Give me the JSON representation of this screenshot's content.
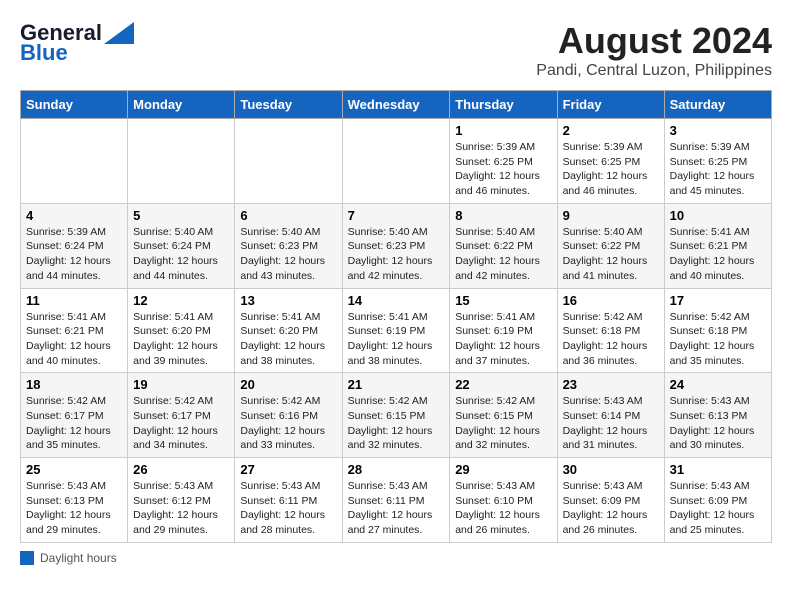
{
  "header": {
    "logo_general": "General",
    "logo_blue": "Blue",
    "month_year": "August 2024",
    "location": "Pandi, Central Luzon, Philippines"
  },
  "days_of_week": [
    "Sunday",
    "Monday",
    "Tuesday",
    "Wednesday",
    "Thursday",
    "Friday",
    "Saturday"
  ],
  "weeks": [
    [
      {
        "day": "",
        "info": ""
      },
      {
        "day": "",
        "info": ""
      },
      {
        "day": "",
        "info": ""
      },
      {
        "day": "",
        "info": ""
      },
      {
        "day": "1",
        "info": "Sunrise: 5:39 AM\nSunset: 6:25 PM\nDaylight: 12 hours\nand 46 minutes."
      },
      {
        "day": "2",
        "info": "Sunrise: 5:39 AM\nSunset: 6:25 PM\nDaylight: 12 hours\nand 46 minutes."
      },
      {
        "day": "3",
        "info": "Sunrise: 5:39 AM\nSunset: 6:25 PM\nDaylight: 12 hours\nand 45 minutes."
      }
    ],
    [
      {
        "day": "4",
        "info": "Sunrise: 5:39 AM\nSunset: 6:24 PM\nDaylight: 12 hours\nand 44 minutes."
      },
      {
        "day": "5",
        "info": "Sunrise: 5:40 AM\nSunset: 6:24 PM\nDaylight: 12 hours\nand 44 minutes."
      },
      {
        "day": "6",
        "info": "Sunrise: 5:40 AM\nSunset: 6:23 PM\nDaylight: 12 hours\nand 43 minutes."
      },
      {
        "day": "7",
        "info": "Sunrise: 5:40 AM\nSunset: 6:23 PM\nDaylight: 12 hours\nand 42 minutes."
      },
      {
        "day": "8",
        "info": "Sunrise: 5:40 AM\nSunset: 6:22 PM\nDaylight: 12 hours\nand 42 minutes."
      },
      {
        "day": "9",
        "info": "Sunrise: 5:40 AM\nSunset: 6:22 PM\nDaylight: 12 hours\nand 41 minutes."
      },
      {
        "day": "10",
        "info": "Sunrise: 5:41 AM\nSunset: 6:21 PM\nDaylight: 12 hours\nand 40 minutes."
      }
    ],
    [
      {
        "day": "11",
        "info": "Sunrise: 5:41 AM\nSunset: 6:21 PM\nDaylight: 12 hours\nand 40 minutes."
      },
      {
        "day": "12",
        "info": "Sunrise: 5:41 AM\nSunset: 6:20 PM\nDaylight: 12 hours\nand 39 minutes."
      },
      {
        "day": "13",
        "info": "Sunrise: 5:41 AM\nSunset: 6:20 PM\nDaylight: 12 hours\nand 38 minutes."
      },
      {
        "day": "14",
        "info": "Sunrise: 5:41 AM\nSunset: 6:19 PM\nDaylight: 12 hours\nand 38 minutes."
      },
      {
        "day": "15",
        "info": "Sunrise: 5:41 AM\nSunset: 6:19 PM\nDaylight: 12 hours\nand 37 minutes."
      },
      {
        "day": "16",
        "info": "Sunrise: 5:42 AM\nSunset: 6:18 PM\nDaylight: 12 hours\nand 36 minutes."
      },
      {
        "day": "17",
        "info": "Sunrise: 5:42 AM\nSunset: 6:18 PM\nDaylight: 12 hours\nand 35 minutes."
      }
    ],
    [
      {
        "day": "18",
        "info": "Sunrise: 5:42 AM\nSunset: 6:17 PM\nDaylight: 12 hours\nand 35 minutes."
      },
      {
        "day": "19",
        "info": "Sunrise: 5:42 AM\nSunset: 6:17 PM\nDaylight: 12 hours\nand 34 minutes."
      },
      {
        "day": "20",
        "info": "Sunrise: 5:42 AM\nSunset: 6:16 PM\nDaylight: 12 hours\nand 33 minutes."
      },
      {
        "day": "21",
        "info": "Sunrise: 5:42 AM\nSunset: 6:15 PM\nDaylight: 12 hours\nand 32 minutes."
      },
      {
        "day": "22",
        "info": "Sunrise: 5:42 AM\nSunset: 6:15 PM\nDaylight: 12 hours\nand 32 minutes."
      },
      {
        "day": "23",
        "info": "Sunrise: 5:43 AM\nSunset: 6:14 PM\nDaylight: 12 hours\nand 31 minutes."
      },
      {
        "day": "24",
        "info": "Sunrise: 5:43 AM\nSunset: 6:13 PM\nDaylight: 12 hours\nand 30 minutes."
      }
    ],
    [
      {
        "day": "25",
        "info": "Sunrise: 5:43 AM\nSunset: 6:13 PM\nDaylight: 12 hours\nand 29 minutes."
      },
      {
        "day": "26",
        "info": "Sunrise: 5:43 AM\nSunset: 6:12 PM\nDaylight: 12 hours\nand 29 minutes."
      },
      {
        "day": "27",
        "info": "Sunrise: 5:43 AM\nSunset: 6:11 PM\nDaylight: 12 hours\nand 28 minutes."
      },
      {
        "day": "28",
        "info": "Sunrise: 5:43 AM\nSunset: 6:11 PM\nDaylight: 12 hours\nand 27 minutes."
      },
      {
        "day": "29",
        "info": "Sunrise: 5:43 AM\nSunset: 6:10 PM\nDaylight: 12 hours\nand 26 minutes."
      },
      {
        "day": "30",
        "info": "Sunrise: 5:43 AM\nSunset: 6:09 PM\nDaylight: 12 hours\nand 26 minutes."
      },
      {
        "day": "31",
        "info": "Sunrise: 5:43 AM\nSunset: 6:09 PM\nDaylight: 12 hours\nand 25 minutes."
      }
    ]
  ],
  "legend": {
    "text": "Daylight hours"
  }
}
